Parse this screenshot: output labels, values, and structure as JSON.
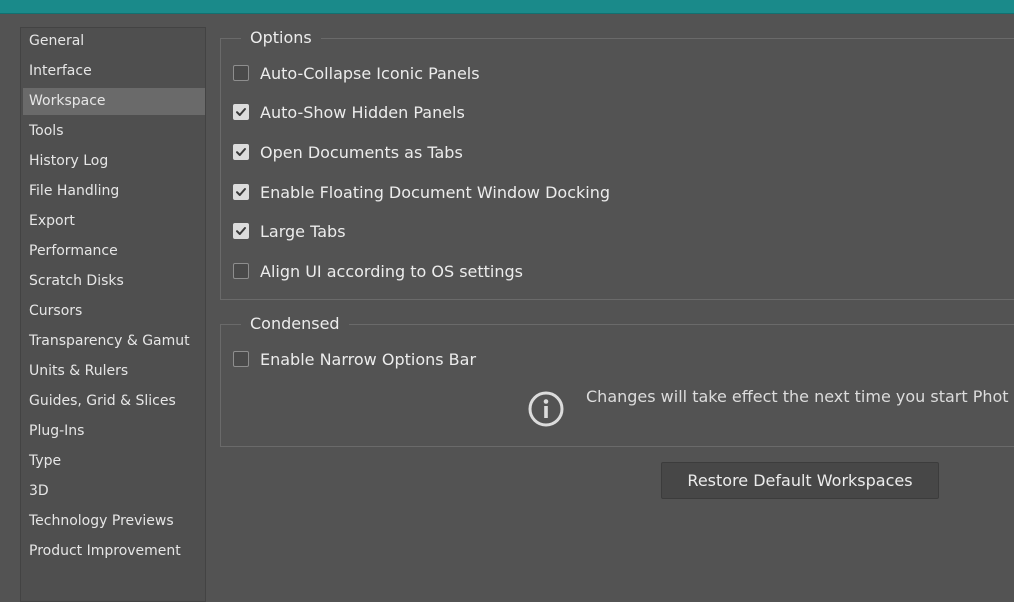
{
  "sidebar": {
    "selected_index": 2,
    "items": [
      {
        "label": "General"
      },
      {
        "label": "Interface"
      },
      {
        "label": "Workspace"
      },
      {
        "label": "Tools"
      },
      {
        "label": "History Log"
      },
      {
        "label": "File Handling"
      },
      {
        "label": "Export"
      },
      {
        "label": "Performance"
      },
      {
        "label": "Scratch Disks"
      },
      {
        "label": "Cursors"
      },
      {
        "label": "Transparency & Gamut"
      },
      {
        "label": "Units & Rulers"
      },
      {
        "label": "Guides, Grid & Slices"
      },
      {
        "label": "Plug-Ins"
      },
      {
        "label": "Type"
      },
      {
        "label": "3D"
      },
      {
        "label": "Technology Previews"
      },
      {
        "label": "Product Improvement"
      }
    ]
  },
  "options": {
    "title": "Options",
    "items": [
      {
        "label": "Auto-Collapse Iconic Panels",
        "checked": false
      },
      {
        "label": "Auto-Show Hidden Panels",
        "checked": true
      },
      {
        "label": "Open Documents as Tabs",
        "checked": true
      },
      {
        "label": "Enable Floating Document Window Docking",
        "checked": true
      },
      {
        "label": "Large Tabs",
        "checked": true
      },
      {
        "label": "Align UI according to OS settings",
        "checked": false
      }
    ]
  },
  "condensed": {
    "title": "Condensed",
    "items": [
      {
        "label": "Enable Narrow Options Bar",
        "checked": false
      }
    ],
    "info_icon": "info-icon",
    "info_text": "Changes will take effect the next time you start Phot"
  },
  "restore_button_label": "Restore Default Workspaces",
  "colors": {
    "titlebar": "#1a8a8a",
    "background": "#535353",
    "selected_item": "#6a6a6a"
  }
}
